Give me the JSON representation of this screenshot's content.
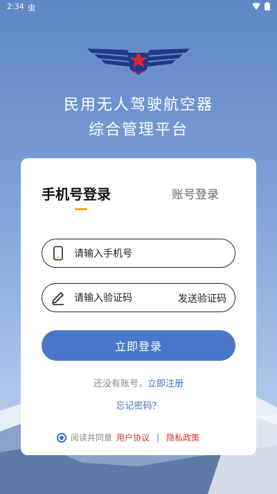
{
  "status_bar": {
    "time": "2:34",
    "bug_glyph": "虫"
  },
  "header": {
    "title_line1": "民用无人驾驶航空器",
    "title_line2": "综合管理平台"
  },
  "tabs": {
    "phone_login": "手机号登录",
    "account_login": "账号登录"
  },
  "phone_field": {
    "placeholder": "请输入手机号",
    "icon": "phone-icon"
  },
  "code_field": {
    "placeholder": "请输入验证码",
    "send_label": "发送验证码",
    "icon": "pen-icon"
  },
  "login_button": "立即登录",
  "register": {
    "prompt": "还没有账号，",
    "link": "立即注册"
  },
  "forgot_password": "忘记密码？",
  "agreement": {
    "prefix": "阅读并同意",
    "user_agreement": "用户协议",
    "separator": "|",
    "privacy_policy": "隐私政策"
  },
  "colors": {
    "primary": "#4a77c9",
    "accent": "#f5a524",
    "link": "#3e6fc5",
    "danger": "#d8322b"
  }
}
